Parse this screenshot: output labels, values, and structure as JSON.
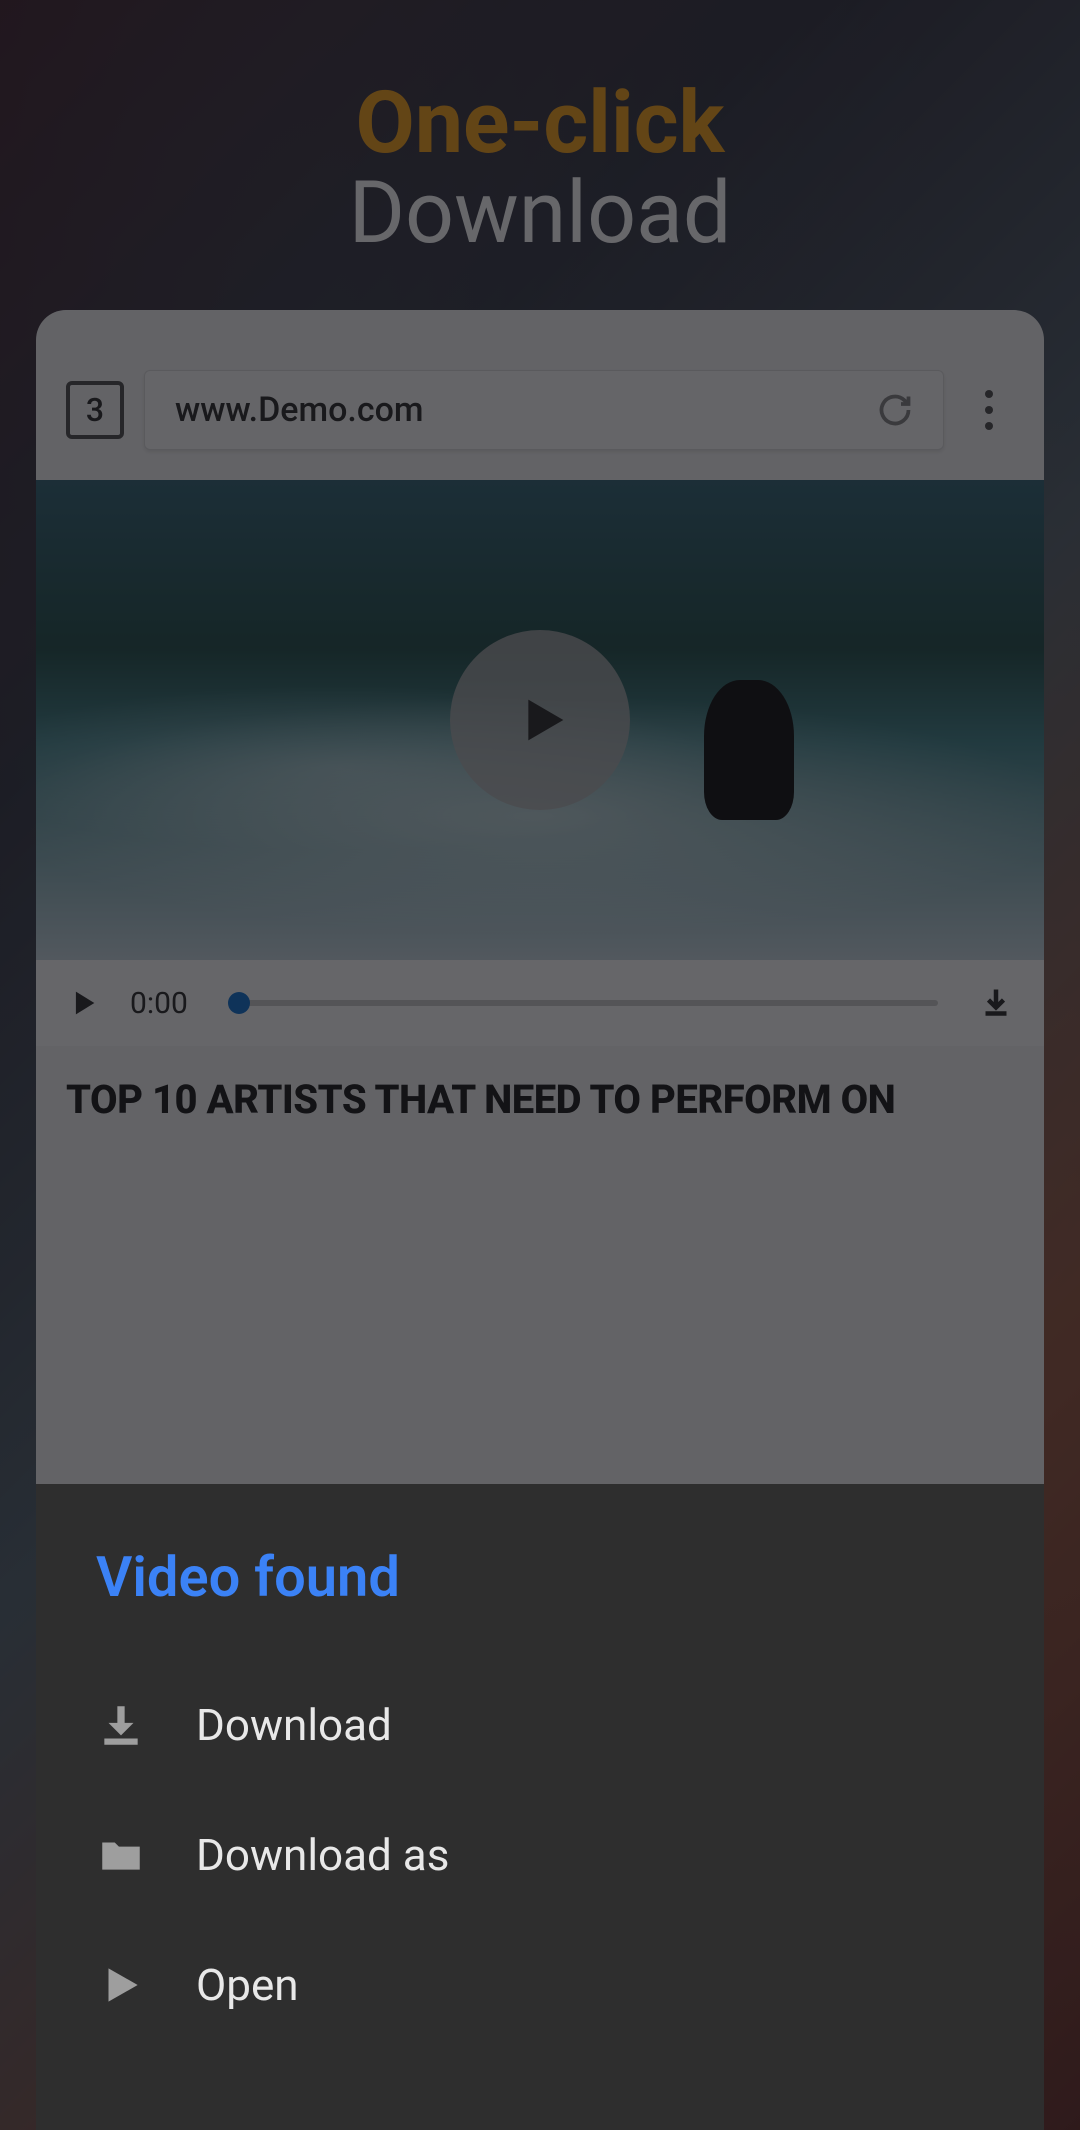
{
  "headline": {
    "line1": "One-click",
    "line2": "Download"
  },
  "browser": {
    "tab_count": "3",
    "url": "www.Demo.com"
  },
  "player": {
    "time": "0:00"
  },
  "article": {
    "title": "TOP 10 ARTISTS THAT NEED TO PERFORM ON"
  },
  "sheet": {
    "title": "Video found",
    "download": "Download",
    "download_as": "Download as",
    "open": "Open"
  }
}
